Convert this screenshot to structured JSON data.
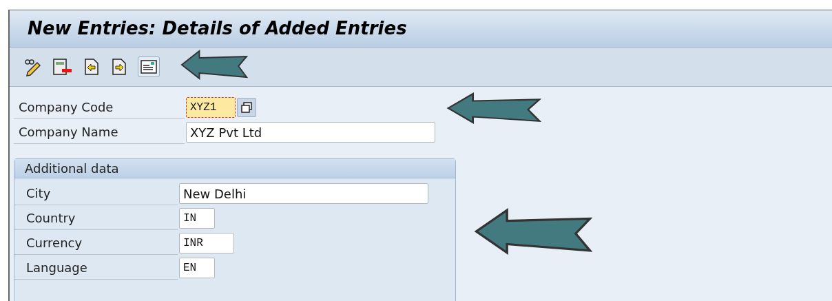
{
  "window": {
    "title": "New Entries: Details of Added Entries"
  },
  "fields": [
    {
      "label": "Company Code",
      "value": "XYZ1",
      "kind": "mono",
      "focused": true,
      "help": true
    },
    {
      "label": "Company Name",
      "value": "XYZ Pvt Ltd",
      "kind": "text",
      "focused": false,
      "help": false
    }
  ],
  "group": {
    "title": "Additional data",
    "fields": [
      {
        "label": "City",
        "value": "New Delhi",
        "kind": "text"
      },
      {
        "label": "Country",
        "value": "IN",
        "kind": "mono"
      },
      {
        "label": "Currency",
        "value": "INR",
        "kind": "mono"
      },
      {
        "label": "Language",
        "value": "EN",
        "kind": "mono"
      }
    ]
  }
}
